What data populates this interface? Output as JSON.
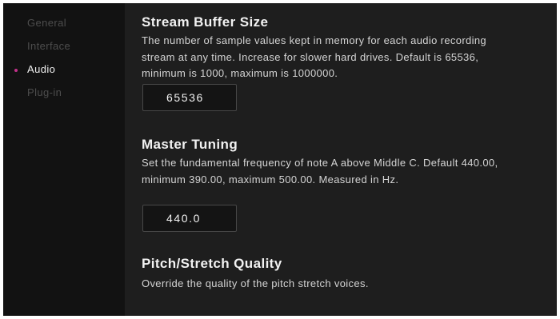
{
  "sidebar": {
    "items": [
      {
        "label": "General",
        "active": false
      },
      {
        "label": "Interface",
        "active": false
      },
      {
        "label": "Audio",
        "active": true
      },
      {
        "label": "Plug-in",
        "active": false
      }
    ],
    "active_dot_color": "#c2308a"
  },
  "sections": {
    "stream_buffer": {
      "title": "Stream Buffer Size",
      "description": "The number of sample values kept in memory for each audio recording stream at any time. Increase for slower hard drives. Default is 65536, minimum is 1000, maximum is 1000000.",
      "value": "65536"
    },
    "master_tuning": {
      "title": "Master Tuning",
      "description": "Set the fundamental frequency of note A above Middle C. Default 440.00, minimum 390.00, maximum 500.00. Measured in Hz.",
      "value": "440.0"
    },
    "pitch_stretch": {
      "title": "Pitch/Stretch Quality",
      "description": "Override the quality of the pitch stretch voices."
    }
  },
  "colors": {
    "sidebar_bg": "#121212",
    "content_bg": "#1e1e1e",
    "field_bg": "#141414",
    "text_primary": "#f2f2f2",
    "text_muted": "#4d4d4d"
  }
}
